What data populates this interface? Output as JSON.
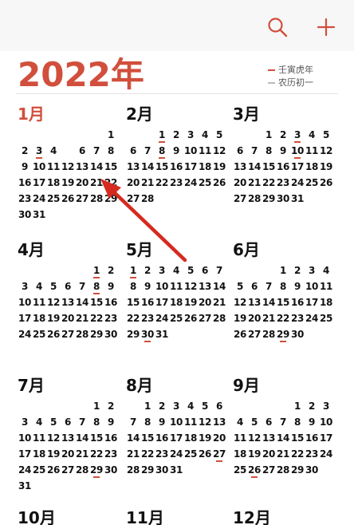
{
  "toolbar": {
    "search_icon": "search-icon",
    "add_icon": "plus-icon",
    "accent": "#d14f3c"
  },
  "year_title": "2022年",
  "legend": {
    "items": [
      {
        "label": "壬寅虎年",
        "color": "#d14f3c"
      },
      {
        "label": "农历初一",
        "color": "#bbbbbb"
      }
    ]
  },
  "today": {
    "month": 1,
    "day": 5
  },
  "months": [
    {
      "name": "1月",
      "current": true,
      "weeks": [
        [
          "",
          "",
          "",
          "",
          "",
          "",
          "1"
        ],
        [
          "2",
          "3",
          "4",
          "5",
          "6",
          "7",
          "8"
        ],
        [
          "9",
          "10",
          "11",
          "12",
          "13",
          "14",
          "15"
        ],
        [
          "16",
          "17",
          "18",
          "19",
          "20",
          "21",
          "22"
        ],
        [
          "23",
          "24",
          "25",
          "26",
          "27",
          "28",
          "29"
        ],
        [
          "30",
          "31"
        ]
      ],
      "marked_days": [
        "3"
      ]
    },
    {
      "name": "2月",
      "current": false,
      "weeks": [
        [
          "",
          "",
          "1",
          "2",
          "3",
          "4",
          "5"
        ],
        [
          "6",
          "7",
          "8",
          "9",
          "10",
          "11",
          "12"
        ],
        [
          "13",
          "14",
          "15",
          "16",
          "17",
          "18",
          "19"
        ],
        [
          "20",
          "21",
          "22",
          "23",
          "24",
          "25",
          "26"
        ],
        [
          "27",
          "28"
        ]
      ],
      "marked_days": [
        "1",
        "8"
      ]
    },
    {
      "name": "3月",
      "current": false,
      "weeks": [
        [
          "",
          "",
          "1",
          "2",
          "3",
          "4",
          "5"
        ],
        [
          "6",
          "7",
          "8",
          "9",
          "10",
          "11",
          "12"
        ],
        [
          "13",
          "14",
          "15",
          "16",
          "17",
          "18",
          "19"
        ],
        [
          "20",
          "21",
          "22",
          "23",
          "24",
          "25",
          "26"
        ],
        [
          "27",
          "28",
          "29",
          "30",
          "31"
        ]
      ],
      "marked_days": [
        "3",
        "10"
      ]
    },
    {
      "name": "4月",
      "current": false,
      "weeks": [
        [
          "",
          "",
          "",
          "",
          "",
          "1",
          "2"
        ],
        [
          "3",
          "4",
          "5",
          "6",
          "7",
          "8",
          "9"
        ],
        [
          "10",
          "11",
          "12",
          "13",
          "14",
          "15",
          "16"
        ],
        [
          "17",
          "18",
          "19",
          "20",
          "21",
          "22",
          "23"
        ],
        [
          "24",
          "25",
          "26",
          "27",
          "28",
          "29",
          "30"
        ]
      ],
      "marked_days": [
        "1",
        "8"
      ]
    },
    {
      "name": "5月",
      "current": false,
      "weeks": [
        [
          "1",
          "2",
          "3",
          "4",
          "5",
          "6",
          "7"
        ],
        [
          "8",
          "9",
          "10",
          "11",
          "12",
          "13",
          "14"
        ],
        [
          "15",
          "16",
          "17",
          "18",
          "19",
          "20",
          "21"
        ],
        [
          "22",
          "23",
          "24",
          "25",
          "26",
          "27",
          "28"
        ],
        [
          "29",
          "30",
          "31"
        ]
      ],
      "marked_days": [
        "1",
        "30"
      ]
    },
    {
      "name": "6月",
      "current": false,
      "weeks": [
        [
          "",
          "",
          "",
          "1",
          "2",
          "3",
          "4"
        ],
        [
          "5",
          "6",
          "7",
          "8",
          "9",
          "10",
          "11"
        ],
        [
          "12",
          "13",
          "14",
          "15",
          "16",
          "17",
          "18"
        ],
        [
          "19",
          "20",
          "21",
          "22",
          "23",
          "24",
          "25"
        ],
        [
          "26",
          "27",
          "28",
          "29",
          "30"
        ]
      ],
      "marked_days": [
        "29"
      ]
    },
    {
      "name": "7月",
      "current": false,
      "weeks": [
        [
          "",
          "",
          "",
          "",
          "",
          "1",
          "2"
        ],
        [
          "3",
          "4",
          "5",
          "6",
          "7",
          "8",
          "9"
        ],
        [
          "10",
          "11",
          "12",
          "13",
          "14",
          "15",
          "16"
        ],
        [
          "17",
          "18",
          "19",
          "20",
          "21",
          "22",
          "23"
        ],
        [
          "24",
          "25",
          "26",
          "27",
          "28",
          "29",
          "30"
        ],
        [
          "31"
        ]
      ],
      "marked_days": [
        "29"
      ]
    },
    {
      "name": "8月",
      "current": false,
      "weeks": [
        [
          "",
          "1",
          "2",
          "3",
          "4",
          "5",
          "6"
        ],
        [
          "7",
          "8",
          "9",
          "10",
          "11",
          "12",
          "13"
        ],
        [
          "14",
          "15",
          "16",
          "17",
          "18",
          "19",
          "20"
        ],
        [
          "21",
          "22",
          "23",
          "24",
          "25",
          "26",
          "27"
        ],
        [
          "28",
          "29",
          "30",
          "31"
        ]
      ],
      "marked_days": [
        "27"
      ]
    },
    {
      "name": "9月",
      "current": false,
      "weeks": [
        [
          "",
          "",
          "",
          "",
          "1",
          "2",
          "3"
        ],
        [
          "4",
          "5",
          "6",
          "7",
          "8",
          "9",
          "10"
        ],
        [
          "11",
          "12",
          "13",
          "14",
          "15",
          "16",
          "17"
        ],
        [
          "18",
          "19",
          "20",
          "21",
          "22",
          "23",
          "24"
        ],
        [
          "25",
          "26",
          "27",
          "28",
          "29",
          "30"
        ]
      ],
      "marked_days": [
        "26"
      ]
    },
    {
      "name": "10月",
      "current": false,
      "weeks": []
    },
    {
      "name": "11月",
      "current": false,
      "weeks": []
    },
    {
      "name": "12月",
      "current": false,
      "weeks": []
    }
  ]
}
